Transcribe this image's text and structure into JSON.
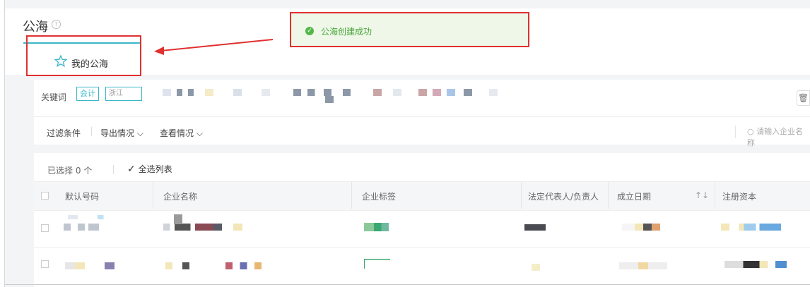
{
  "page": {
    "title": "公海",
    "help": "?"
  },
  "tab": {
    "label": "我的公海"
  },
  "toast": {
    "message": "公海创建成功"
  },
  "filter": {
    "keyword_label": "关键词",
    "tags": [
      "会计",
      "浙江"
    ]
  },
  "toolbar": {
    "filter_conditions": "过滤条件",
    "export": "导出情况",
    "view": "查看情况",
    "search_placeholder": "请输入企业名称"
  },
  "selection": {
    "label": "已选择",
    "count": "0",
    "unit": "个",
    "select_all": "全选列表"
  },
  "table": {
    "headers": [
      "默认号码",
      "企业名称",
      "企业标签",
      "法定代表人/负责人",
      "成立日期",
      "注册资本"
    ],
    "sort_icon": "↑↓"
  },
  "icons": {
    "tab": "star-icon",
    "toast": "check-circle-icon",
    "trash": "trash-icon",
    "search": "search-icon",
    "chevron": "chevron-down-icon"
  },
  "colors": {
    "accent": "#3ab7c8",
    "annotation": "#e03030",
    "success": "#52b84a"
  }
}
